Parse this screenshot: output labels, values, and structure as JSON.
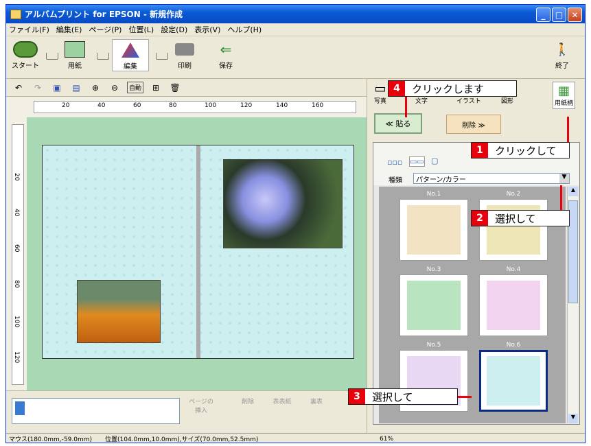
{
  "window": {
    "title": "アルバムプリント for EPSON - 新規作成"
  },
  "menu": [
    "ファイル(F)",
    "編集(E)",
    "ページ(P)",
    "位置(L)",
    "設定(D)",
    "表示(V)",
    "ヘルプ(H)"
  ],
  "toolbar": {
    "start": "スタート",
    "paper": "用紙",
    "edit": "編集",
    "print": "印刷",
    "save": "保存",
    "exit": "終了"
  },
  "subtool": {
    "zoom_label": "自動"
  },
  "ruler": {
    "top_ticks": [
      "20",
      "40",
      "60",
      "80",
      "100",
      "120",
      "140",
      "160"
    ],
    "left_ticks": [
      "20",
      "40",
      "60",
      "80",
      "100",
      "120"
    ]
  },
  "right": {
    "tabs": [
      "写真",
      "文字",
      "イラスト",
      "図形",
      "用紙柄"
    ],
    "paste": "≪ 貼る",
    "delete": "削除 ≫",
    "kind_label": "種類",
    "kind_value": "パターン/カラー"
  },
  "patterns": [
    {
      "label": "No.1",
      "color": "#f2e4c2"
    },
    {
      "label": "No.2",
      "color": "#eee6b6"
    },
    {
      "label": "No.3",
      "color": "#b8e4c0"
    },
    {
      "label": "No.4",
      "color": "#f2d4f0"
    },
    {
      "label": "No.5",
      "color": "#e8d8f4"
    },
    {
      "label": "No.6",
      "color": "#cdeff0"
    }
  ],
  "bottom": {
    "insert": "ページの挿入",
    "del": "削除",
    "front": "表表紙",
    "back": "裏表"
  },
  "status": {
    "mouse": "マウス(180.0mm,-59.0mm)",
    "position": "位置(104.0mm,10.0mm),サイズ(70.0mm,52.5mm)",
    "zoom": "61%"
  },
  "callouts": [
    {
      "num": "1",
      "text": "クリックして"
    },
    {
      "num": "2",
      "text": "選択して"
    },
    {
      "num": "3",
      "text": "選択して"
    },
    {
      "num": "4",
      "text": "クリックします"
    }
  ],
  "colors": {
    "accent": "#e8000d",
    "title_blue": "#0a5ad6",
    "canvas_green": "#a8d8b4"
  }
}
